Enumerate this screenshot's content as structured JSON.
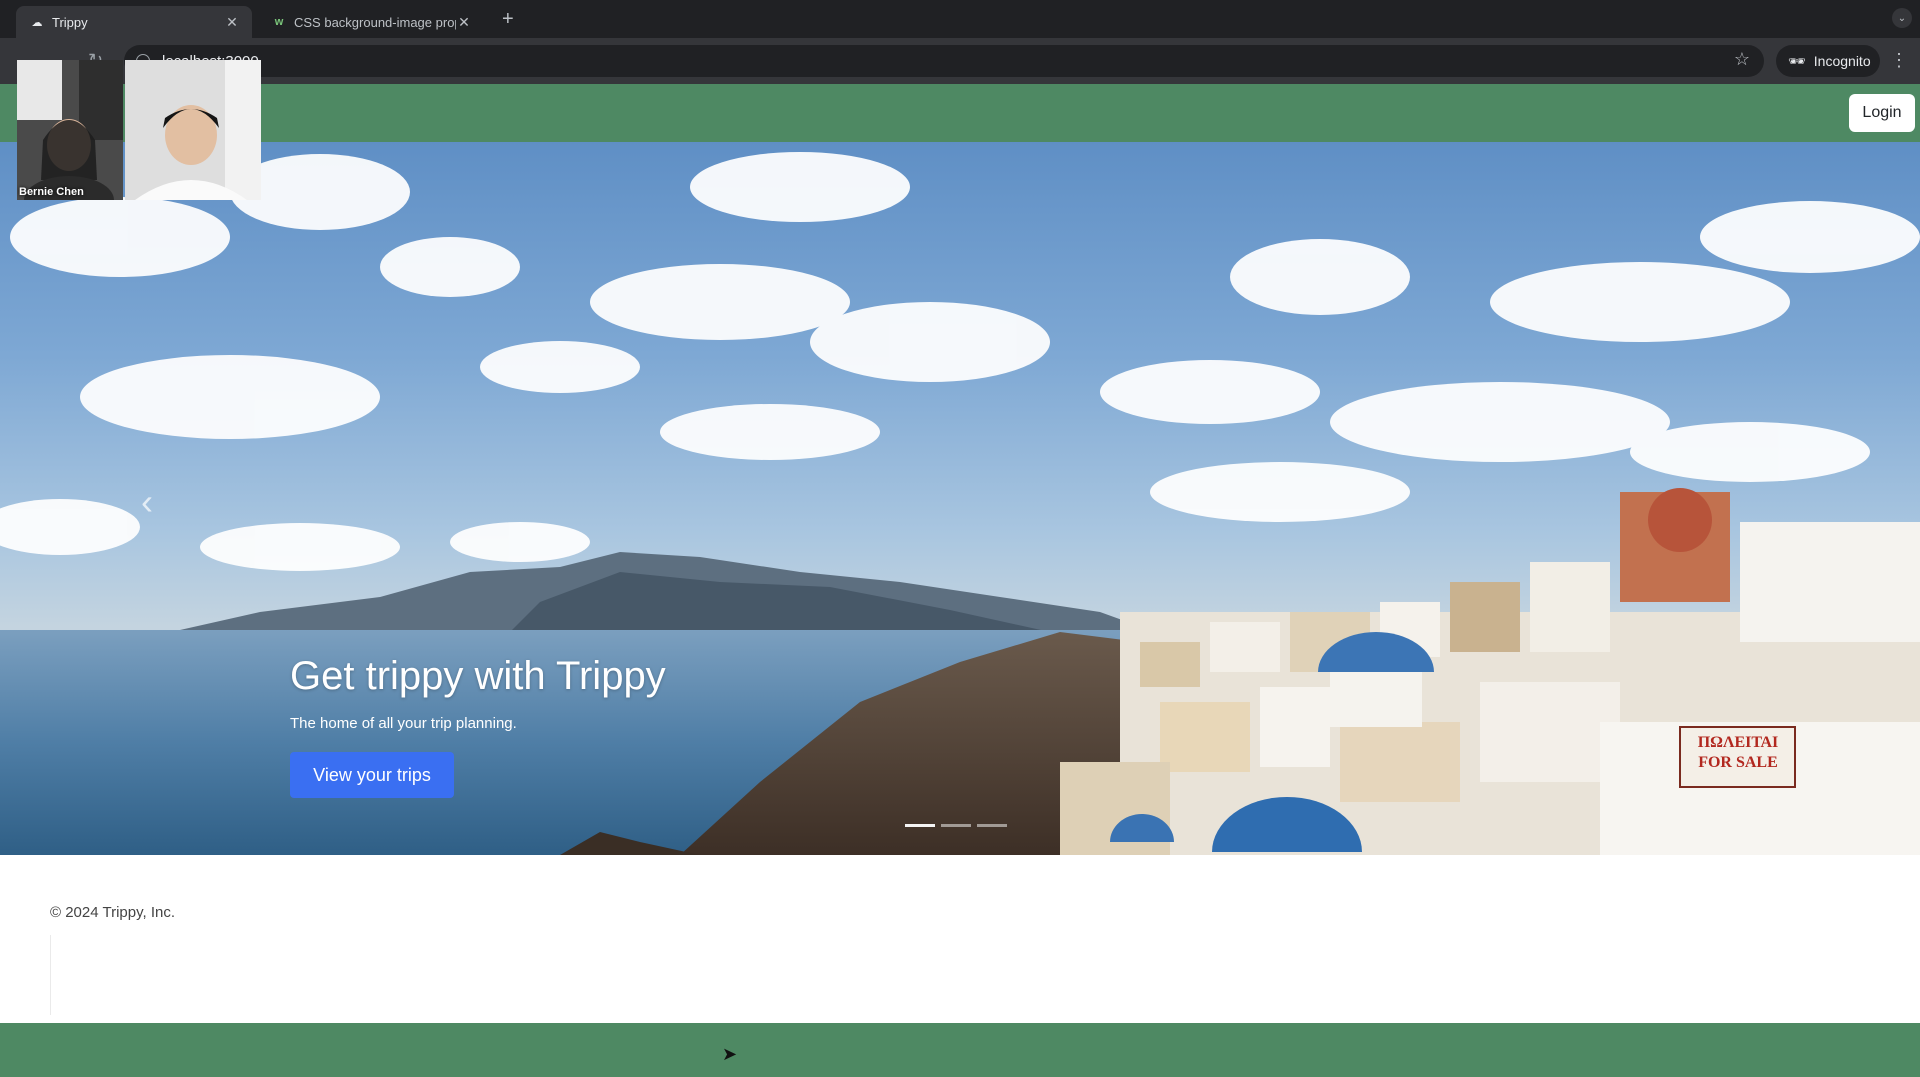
{
  "browser": {
    "tabs": [
      {
        "title": "Trippy",
        "favicon": "cloud-favicon",
        "active": true
      },
      {
        "title": "CSS background-image prope",
        "favicon": "w3-favicon",
        "active": false
      }
    ],
    "url": "localhost:3000",
    "incognito_label": "Incognito"
  },
  "navbar": {
    "login_label": "Login",
    "color": "#4e8963"
  },
  "hero": {
    "title": "Get trippy with Trippy",
    "subtitle": "The home of all your trip planning.",
    "cta_label": "View your trips",
    "cta_color": "#3a6ff2",
    "indicators": [
      true,
      false,
      false
    ]
  },
  "footer": {
    "copyright": "© 2024 Trippy, Inc."
  },
  "video_call": {
    "participants": [
      {
        "name": "Bernie Chen"
      },
      {
        "name": ""
      }
    ]
  }
}
